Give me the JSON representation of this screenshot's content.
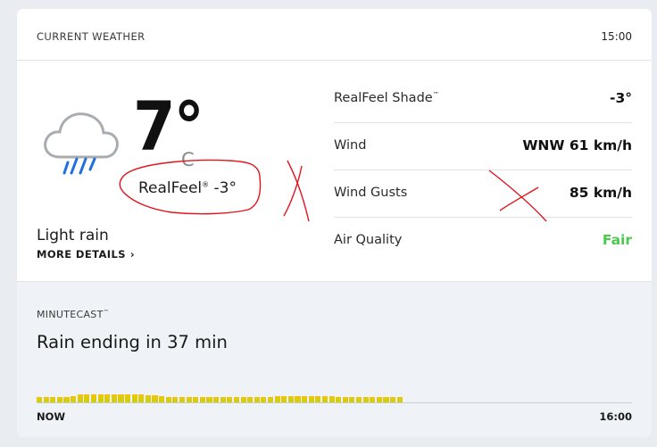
{
  "header": {
    "title": "CURRENT WEATHER",
    "time": "15:00"
  },
  "current": {
    "icon": "rain-cloud-icon",
    "temperature": "7°",
    "unit": "C",
    "realfeel_label": "RealFeel",
    "realfeel_mark": "®",
    "realfeel_value": "-3°",
    "condition": "Light rain",
    "more_details": "MORE DETAILS"
  },
  "details": [
    {
      "label": "RealFeel Shade",
      "mark": "™",
      "value": "-3°",
      "value_color": "#111111"
    },
    {
      "label": "Wind",
      "mark": "",
      "value": "WNW 61 km/h",
      "value_color": "#111111"
    },
    {
      "label": "Wind Gusts",
      "mark": "",
      "value": "85 km/h",
      "value_color": "#111111"
    },
    {
      "label": "Air Quality",
      "mark": "",
      "value": "Fair",
      "value_color": "#4cc94f"
    }
  ],
  "minutecast": {
    "title": "MINUTECAST",
    "mark": "™",
    "summary": "Rain ending in 37 min",
    "start_label": "NOW",
    "end_label": "16:00",
    "total_minutes": 60,
    "rain_minutes": 37,
    "intensity": [
      0.55,
      0.55,
      0.55,
      0.6,
      0.6,
      0.7,
      0.8,
      0.8,
      0.8,
      0.8,
      0.8,
      0.8,
      0.8,
      0.8,
      0.8,
      0.8,
      0.75,
      0.75,
      0.65,
      0.6,
      0.55,
      0.55,
      0.55,
      0.55,
      0.6,
      0.6,
      0.6,
      0.6,
      0.6,
      0.55,
      0.55,
      0.55,
      0.55,
      0.6,
      0.6,
      0.65,
      0.65,
      0.7,
      0.7,
      0.7,
      0.65,
      0.65,
      0.65,
      0.65,
      0.6,
      0.6,
      0.6,
      0.6,
      0.6,
      0.55,
      0.55,
      0.55,
      0.55,
      0.55
    ],
    "colors": {
      "light": "#c8d400",
      "heavy": "#f1c40f"
    }
  },
  "annotations": {
    "color": "#e0141c"
  }
}
